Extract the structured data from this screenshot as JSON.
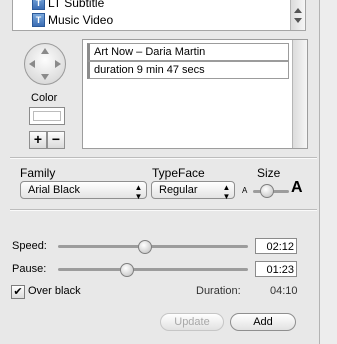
{
  "clips_list": {
    "items": [
      {
        "icon": "text-clip-icon",
        "glyph": "T",
        "label": "LT Subtitle"
      },
      {
        "icon": "text-clip-icon",
        "glyph": "T",
        "label": "Music Video"
      }
    ]
  },
  "position_pad": {
    "icon": "direction-pad-icon"
  },
  "color": {
    "label": "Color",
    "add_glyph": "+",
    "remove_glyph": "−"
  },
  "text_lines": [
    "Art Now – Daria Martin",
    "duration 9 min 47 secs"
  ],
  "font": {
    "family_label": "Family",
    "family_value": "Arial Black",
    "typeface_label": "TypeFace",
    "typeface_value": "Regular",
    "size_label": "Size",
    "size_small_glyph": "A",
    "size_large_glyph": "A",
    "size_level": 0.35,
    "popup_arrow": "▲▼"
  },
  "speed": {
    "label": "Speed:",
    "value": "02:12",
    "level": 0.45
  },
  "pause": {
    "label": "Pause:",
    "value": "01:23",
    "level": 0.36
  },
  "over_black": {
    "label": "Over black",
    "checked": true,
    "check_glyph": "✔"
  },
  "duration": {
    "label": "Duration:",
    "value": "04:10"
  },
  "buttons": {
    "update": "Update",
    "add": "Add"
  }
}
